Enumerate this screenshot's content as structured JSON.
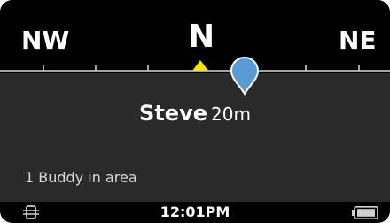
{
  "compass": {
    "left_direction": "NW",
    "center_direction": "N",
    "right_direction": "NE",
    "heading_marker_color": "#f2e600",
    "buddy_marker_color": "#5b9bd5"
  },
  "buddy": {
    "name": "Steve",
    "distance": "20m",
    "count_text": "1 Buddy in area"
  },
  "status": {
    "time": "12:01PM",
    "left_icon": "sync-icon",
    "battery_icon": "battery-icon"
  }
}
